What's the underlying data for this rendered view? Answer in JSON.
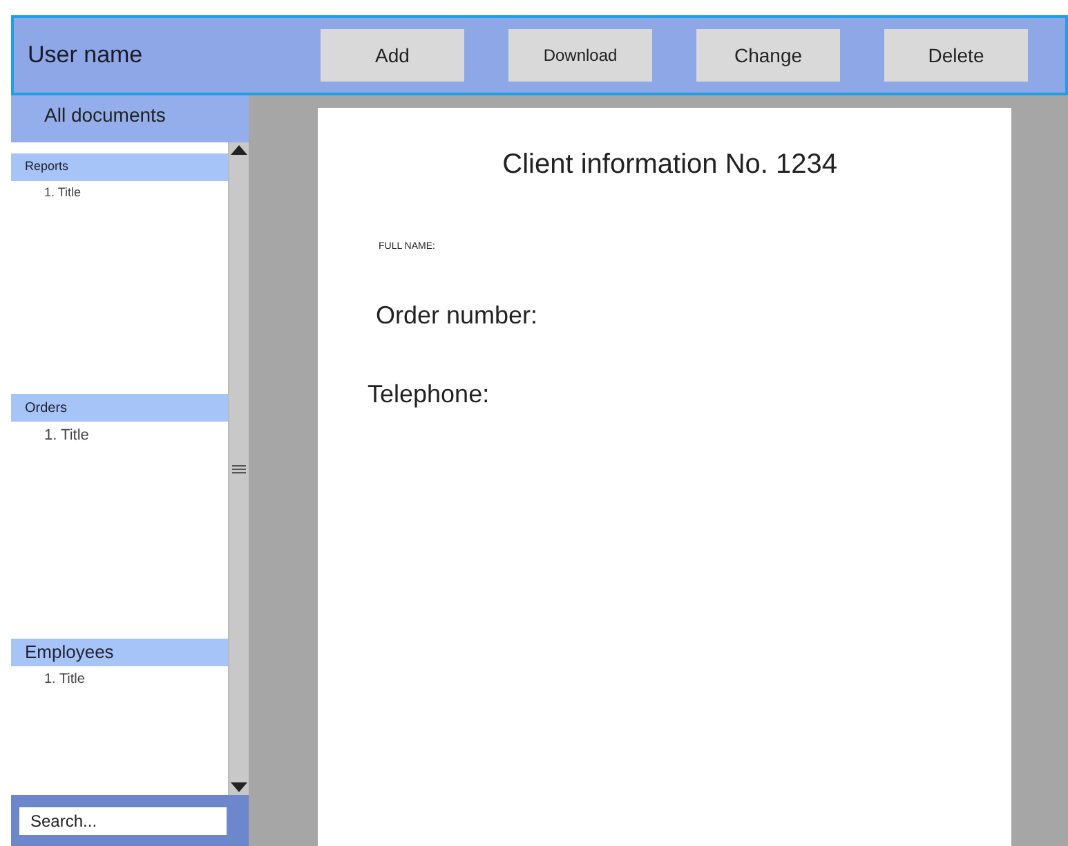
{
  "header": {
    "user_name": "User name",
    "buttons": [
      "Add",
      "Download",
      "Change",
      "Delete"
    ]
  },
  "sidebar": {
    "title": "All documents",
    "sections": [
      {
        "label": "Reports",
        "items": [
          "1. Title"
        ]
      },
      {
        "label": "Orders",
        "items": [
          "1. Title"
        ]
      },
      {
        "label": "Employees",
        "items": [
          "1. Title"
        ]
      }
    ],
    "search": {
      "placeholder": "Search..."
    }
  },
  "document": {
    "title": "Client information No. 1234",
    "fields": [
      {
        "kind": "small",
        "label": "FULL NAME:"
      },
      {
        "kind": "large",
        "label": "Order number:"
      },
      {
        "kind": "large",
        "label": "Telephone:"
      }
    ]
  }
}
